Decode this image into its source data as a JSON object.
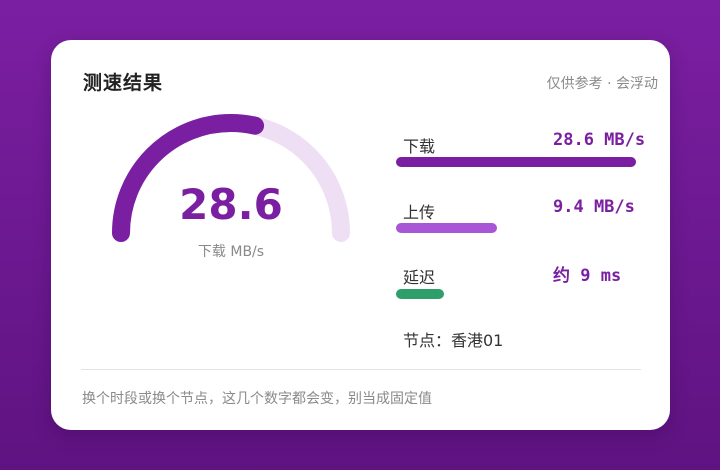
{
  "card": {
    "title": "测速结果",
    "subtitle": "仅供参考 · 会浮动"
  },
  "gauge": {
    "value": "28.6",
    "unit_label": "下载 MB/s",
    "fill_fraction": 0.57
  },
  "metrics": [
    {
      "label": "下载",
      "value": "28.6 MB/s",
      "bar_fraction": 1.0,
      "color": "#7b1fa2"
    },
    {
      "label": "上传",
      "value": "9.4 MB/s",
      "bar_fraction": 0.42,
      "color": "#a855d6"
    },
    {
      "label": "延迟",
      "value": "约 9 ms",
      "bar_fraction": 0.2,
      "color": "#2e9e6a"
    }
  ],
  "node": "节点：香港01",
  "footnote": "换个时段或换个节点，这几个数字都会变，别当成固定值",
  "colors": {
    "accent": "#7b1fa2",
    "track": "#eedff5",
    "background": "#7b1fa2"
  }
}
